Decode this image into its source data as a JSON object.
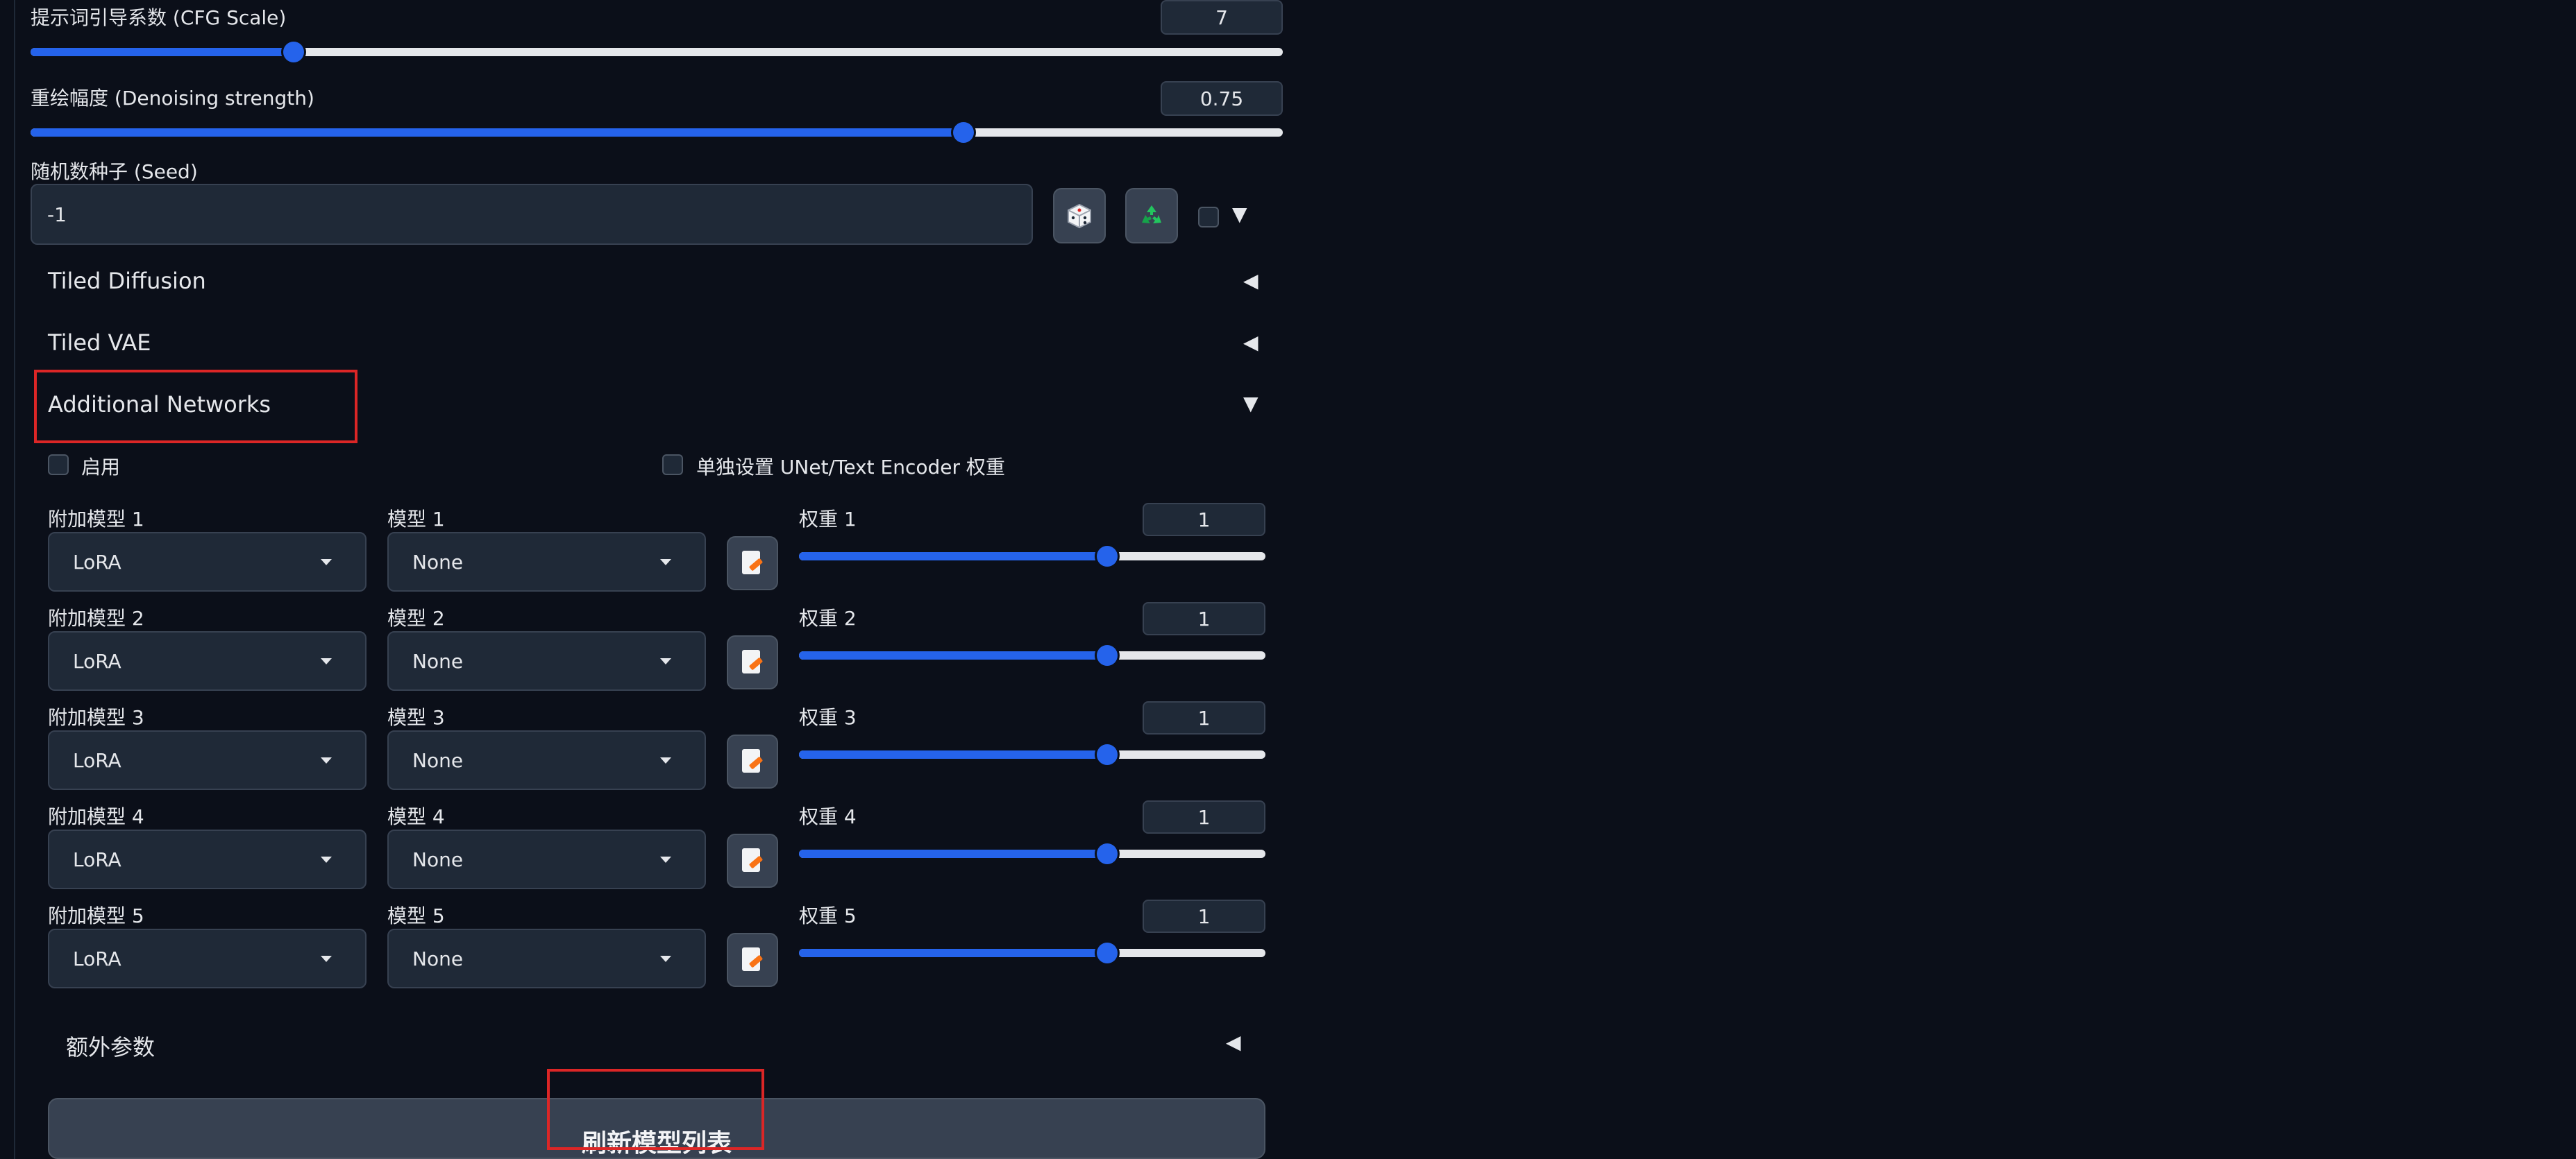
{
  "cfg": {
    "label": "提示词引导系数 (CFG Scale)",
    "value": "7",
    "level": 0.21
  },
  "denoise": {
    "label": "重绘幅度 (Denoising strength)",
    "value": "0.75",
    "level": 0.745
  },
  "seed": {
    "label": "随机数种子 (Seed)",
    "value": "-1",
    "dice_icon": "dice-icon",
    "recycle_icon": "recycle-icon"
  },
  "sections": {
    "tiled_diffusion": "Tiled Diffusion",
    "tiled_vae": "Tiled VAE",
    "additional_networks": "Additional Networks",
    "extra_params": "额外参数"
  },
  "addnet": {
    "enable_label": "启用",
    "separate_weights_label": "单独设置 UNet/Text Encoder 权重",
    "rows": [
      {
        "type_label": "附加模型 1",
        "type_value": "LoRA",
        "model_label": "模型 1",
        "model_value": "None",
        "weight_label": "权重 1",
        "weight_value": "1",
        "level": 0.66
      },
      {
        "type_label": "附加模型 2",
        "type_value": "LoRA",
        "model_label": "模型 2",
        "model_value": "None",
        "weight_label": "权重 2",
        "weight_value": "1",
        "level": 0.66
      },
      {
        "type_label": "附加模型 3",
        "type_value": "LoRA",
        "model_label": "模型 3",
        "model_value": "None",
        "weight_label": "权重 3",
        "weight_value": "1",
        "level": 0.66
      },
      {
        "type_label": "附加模型 4",
        "type_value": "LoRA",
        "model_label": "模型 4",
        "model_value": "None",
        "weight_label": "权重 4",
        "weight_value": "1",
        "level": 0.66
      },
      {
        "type_label": "附加模型 5",
        "type_value": "LoRA",
        "model_label": "模型 5",
        "model_value": "None",
        "weight_label": "权重 5",
        "weight_value": "1",
        "level": 0.66
      }
    ],
    "refresh_label": "刷新模型列表"
  },
  "colors": {
    "accent": "#2563eb",
    "highlight": "#dc2626",
    "background": "#0b0f19"
  }
}
